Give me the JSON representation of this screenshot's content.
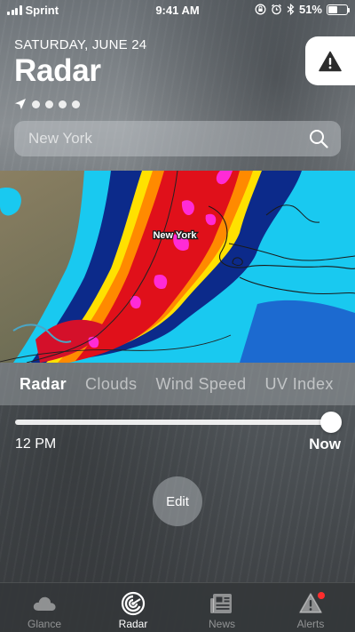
{
  "status_bar": {
    "carrier": "Sprint",
    "time": "9:41 AM",
    "battery": "51%",
    "battery_level": 0.51
  },
  "header": {
    "date": "SATURDAY, JUNE 24",
    "title": "Radar",
    "location_pages": 5
  },
  "search": {
    "placeholder": "New York"
  },
  "map": {
    "city_label": "New York"
  },
  "layers": {
    "tabs": [
      "Radar",
      "Clouds",
      "Wind Speed",
      "UV Index"
    ],
    "active": "Radar"
  },
  "timeline": {
    "start_label": "12 PM",
    "end_label": "Now",
    "progress": 1.0
  },
  "edit_label": "Edit",
  "tab_bar": {
    "items": [
      {
        "label": "Glance",
        "icon": "cloud-icon"
      },
      {
        "label": "Radar",
        "icon": "radar-icon"
      },
      {
        "label": "News",
        "icon": "news-icon"
      },
      {
        "label": "Alerts",
        "icon": "alert-icon"
      }
    ],
    "active": "Radar"
  },
  "colors": {
    "alert_badge": "#ff2d2d",
    "radar_heavy": "#ff2bd6",
    "radar_high": "#e0101a",
    "radar_mid": "#ffe000",
    "radar_low": "#1ec8ff"
  }
}
